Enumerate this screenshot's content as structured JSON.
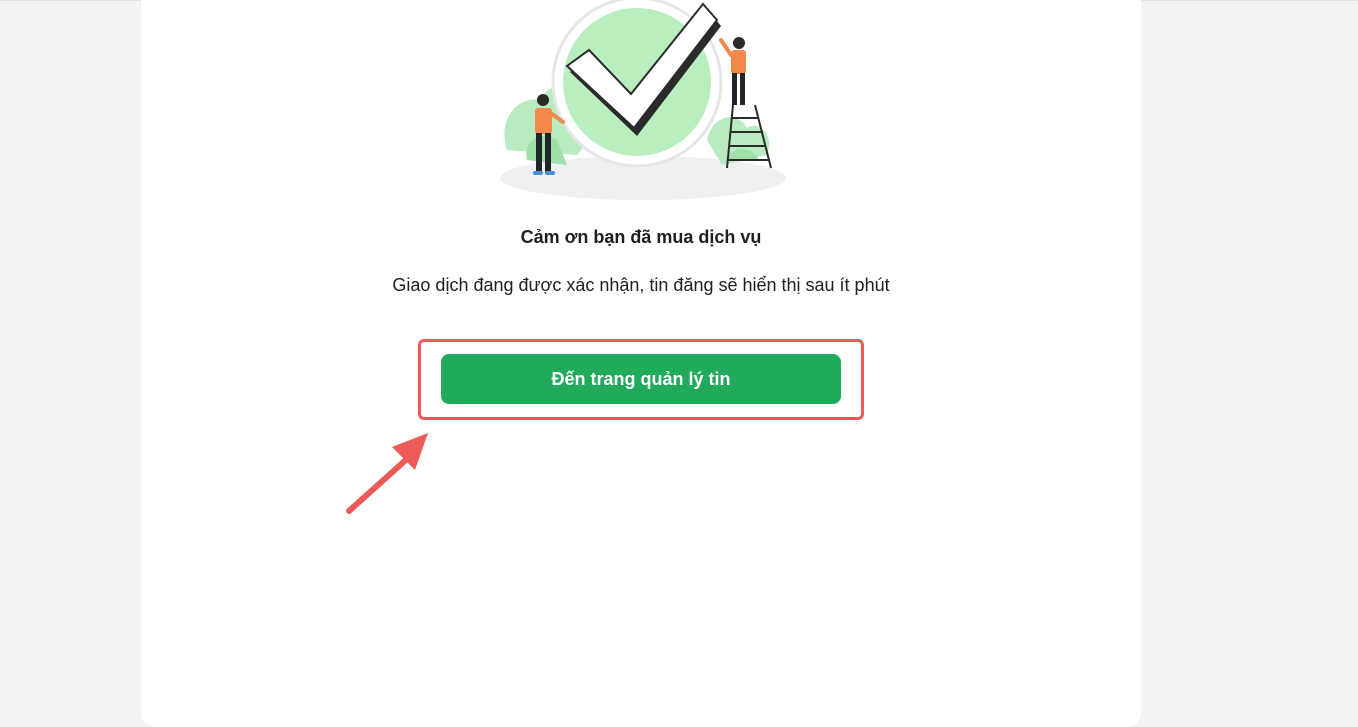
{
  "success": {
    "title": "Cảm ơn bạn đã mua dịch vụ",
    "message": "Giao dịch đang được xác nhận, tin đăng sẽ hiển thị sau ít phút",
    "button_label": "Đến trang quản lý tin"
  },
  "icons": {
    "illustration": "success-checkmark-illustration",
    "annotation": "pointer-arrow-icon"
  },
  "colors": {
    "button": "#21a95c",
    "highlight": "#ec5b57",
    "check_circle": "#b9efbf"
  }
}
